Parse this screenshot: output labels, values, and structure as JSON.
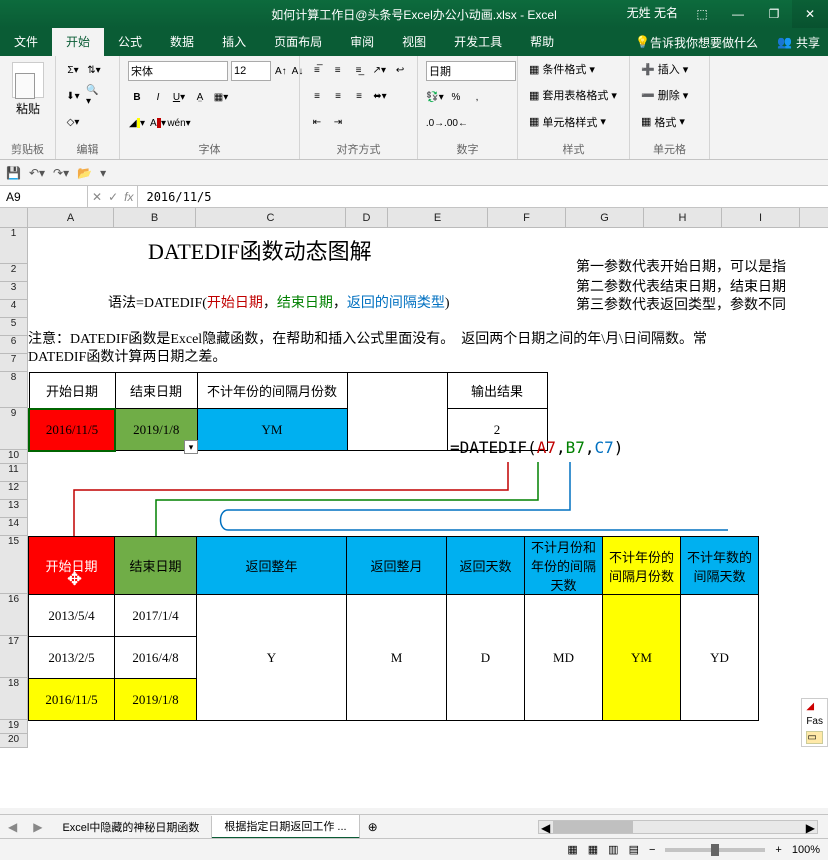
{
  "title": "如何计算工作日@头条号Excel办公小动画.xlsx - Excel",
  "user": "无姓 无名",
  "tabs": [
    "文件",
    "开始",
    "公式",
    "数据",
    "插入",
    "页面布局",
    "审阅",
    "视图",
    "开发工具",
    "帮助"
  ],
  "tell_me": "告诉我你想要做什么",
  "share": "共享",
  "paste": "粘贴",
  "groups": {
    "clipboard": "剪贴板",
    "edit": "编辑",
    "font": "字体",
    "align": "对齐方式",
    "number": "数字",
    "style": "样式",
    "cells": "单元格"
  },
  "font_name": "宋体",
  "font_size": "12",
  "number_format": "日期",
  "style_btns": {
    "cond": "条件格式",
    "tbl": "套用表格格式",
    "cell": "单元格样式"
  },
  "cell_btns": {
    "ins": "插入",
    "del": "删除",
    "fmt": "格式"
  },
  "name_box": "A9",
  "formula": "2016/11/5",
  "cols": {
    "A": 86,
    "B": 82,
    "C": 150,
    "D": 42,
    "E": 100,
    "F": 78,
    "G": 78,
    "H": 78,
    "I": 78
  },
  "row_heights": {
    "default": 18,
    "big": 90
  },
  "doc": {
    "title": "DATEDIF函数动态图解",
    "syntax_pre": "语法=DATEDIF(",
    "syntax_a": "开始日期",
    "syntax_sep": "，",
    "syntax_b": "结束日期",
    "syntax_c": "返回的间隔类型",
    "syntax_end": ")",
    "p1": "第一参数代表开始日期，可以是指",
    "p2": "第二参数代表结束日期，结束日期",
    "p3": "第三参数代表返回类型，参数不同",
    "note": "注意：DATEDIF函数是Excel隐藏函数，在帮助和插入公式里面没有。　返回两个日期之间的年\\月\\日间隔数。常",
    "note2": "DATEDIF函数计算两日期之差。",
    "th1": [
      "开始日期",
      "结束日期",
      "不计年份的间隔月份数",
      "",
      "输出结果"
    ],
    "tr1": [
      "2016/11/5",
      "2019/1/8",
      "YM",
      "",
      "2"
    ],
    "formula_pre": "=DATEDIF(",
    "formula_a": "A7",
    "formula_b": "B7",
    "formula_c": "C7",
    "th2": [
      "开始日期",
      "结束日期",
      "返回整年",
      "返回整月",
      "返回天数",
      "不计月份和年份的间隔天数",
      "不计年份的间隔月份数",
      "不计年数的间隔天数"
    ],
    "rows2": [
      [
        "2013/5/4",
        "2017/1/4",
        "",
        "",
        "",
        "",
        "",
        ""
      ],
      [
        "2013/2/5",
        "2016/4/8",
        "Y",
        "M",
        "D",
        "MD",
        "YM",
        "YD"
      ],
      [
        "2016/11/5",
        "2019/1/8",
        "",
        "",
        "",
        "",
        "",
        ""
      ]
    ]
  },
  "sheet_tabs": [
    "Excel中隐藏的神秘日期函数",
    "根据指定日期返回工作 ..."
  ],
  "zoom": "100%",
  "zoom_out": "−",
  "zoom_in": "+",
  "fast_label": "Fas"
}
